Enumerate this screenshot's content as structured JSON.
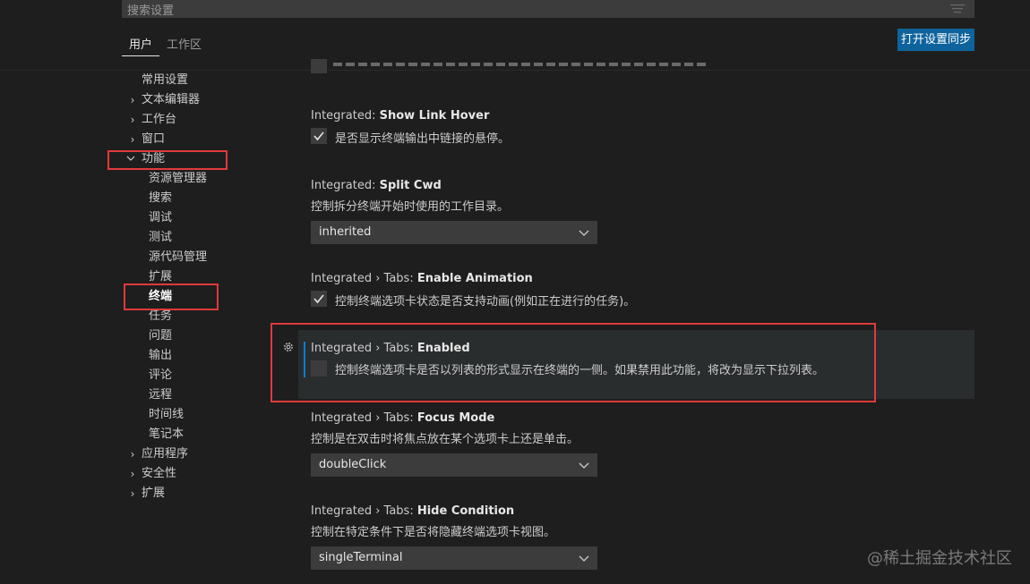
{
  "search": {
    "placeholder": "搜索设置"
  },
  "tabs": [
    {
      "label": "用户",
      "active": true
    },
    {
      "label": "工作区",
      "active": false
    }
  ],
  "sync_button": "打开设置同步",
  "toc": [
    {
      "label": "常用设置",
      "expandable": false
    },
    {
      "label": "文本编辑器",
      "expandable": true,
      "expanded": false
    },
    {
      "label": "工作台",
      "expandable": true,
      "expanded": false
    },
    {
      "label": "窗口",
      "expandable": true,
      "expanded": false
    },
    {
      "label": "功能",
      "expandable": true,
      "expanded": true
    },
    {
      "label": "资源管理器"
    },
    {
      "label": "搜索"
    },
    {
      "label": "调试"
    },
    {
      "label": "测试"
    },
    {
      "label": "源代码管理"
    },
    {
      "label": "扩展"
    },
    {
      "label": "终端",
      "selected": true
    },
    {
      "label": "任务"
    },
    {
      "label": "问题"
    },
    {
      "label": "输出"
    },
    {
      "label": "评论"
    },
    {
      "label": "远程"
    },
    {
      "label": "时间线"
    },
    {
      "label": "笔记本"
    },
    {
      "label": "应用程序",
      "expandable": true,
      "expanded": false
    },
    {
      "label": "安全性",
      "expandable": true,
      "expanded": false
    },
    {
      "label": "扩展",
      "expandable": true,
      "expanded": false
    }
  ],
  "settings": [
    {
      "category": "Integrated: ",
      "name": "Show Link Hover",
      "description": "是否显示终端输出中链接的悬停。",
      "type": "checkbox",
      "checked": true
    },
    {
      "category": "Integrated: ",
      "name": "Split Cwd",
      "description": "控制拆分终端开始时使用的工作目录。",
      "type": "select",
      "value": "inherited"
    },
    {
      "category": "Integrated › Tabs: ",
      "name": "Enable Animation",
      "description": "控制终端选项卡状态是否支持动画(例如正在进行的任务)。",
      "type": "checkbox",
      "checked": true
    },
    {
      "category": "Integrated › Tabs: ",
      "name": "Enabled",
      "description": "控制终端选项卡是否以列表的形式显示在终端的一侧。如果禁用此功能，将改为显示下拉列表。",
      "type": "checkbox",
      "checked": false,
      "focused": true
    },
    {
      "category": "Integrated › Tabs: ",
      "name": "Focus Mode",
      "description": "控制是在双击时将焦点放在某个选项卡上还是单击。",
      "type": "select",
      "value": "doubleClick"
    },
    {
      "category": "Integrated › Tabs: ",
      "name": "Hide Condition",
      "description": "控制在特定条件下是否将隐藏终端选项卡视图。",
      "type": "select",
      "value": "singleTerminal"
    }
  ],
  "watermark": "@稀土掘金技术社区",
  "colors": {
    "accent": "#0e639c",
    "highlight": "#e03a3a",
    "focus_bar": "#007fd4"
  },
  "icons": {
    "filter": "filter-icon",
    "gear": "gear-icon",
    "chevron_right": "chevron-right-icon",
    "chevron_down": "chevron-down-icon",
    "check": "check-icon"
  }
}
